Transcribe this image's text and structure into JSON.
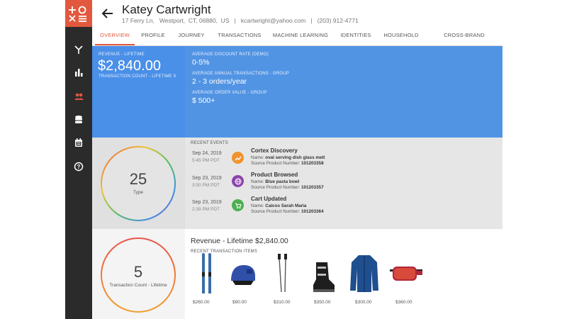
{
  "customer": {
    "name": "Katey Cartwright",
    "address": "17 Ferry Ln,   Westport,  CT, 06880,  US",
    "email": "kcartwright@yahoo.com",
    "phone": "(203) 912-4771"
  },
  "tabs": [
    {
      "label": "OVERVIEW",
      "active": true
    },
    {
      "label": "PROFILE"
    },
    {
      "label": "JOURNEY"
    },
    {
      "label": "TRANSACTIONS"
    },
    {
      "label": "MACHINE LEARNING"
    },
    {
      "label": "IDENTITIES"
    },
    {
      "label": "HOUSEHOLD"
    },
    {
      "label": "CROSS-BRAND CUSTOMER"
    }
  ],
  "summary": {
    "revenue_label": "REVENUE - LIFETIME",
    "revenue_value": "$2,840.00",
    "txn_count_label": "TRANSACTION COUNT - LIFETIME",
    "txn_count_value": "5",
    "discount_label": "AVERAGE DISCOUNT RATE (DEMO)",
    "discount_value": "0-5%",
    "annual_label": "AVERAGE ANNUAL TRANSACTIONS - GROUP",
    "annual_value": "2 - 3 orders/year",
    "aov_label": "AVERAGE ORDER VALUE - GROUP",
    "aov_value": "$ 500+"
  },
  "type_ring": {
    "value": "25",
    "label": "Type"
  },
  "events": {
    "heading": "RECENT EVENTS",
    "items": [
      {
        "date": "Sep 24, 2019",
        "time": "5:45 PM PDT",
        "title": "Cortex Discovery",
        "name_label": "Name:",
        "name": "oval serving dish glass melt",
        "source_label": "Source Product Number:",
        "source": "101203358",
        "icon": "trending-up-icon",
        "color": "#f0932e"
      },
      {
        "date": "Sep 23, 2019",
        "time": "3:50 PM PDT",
        "title": "Product Browsed",
        "name_label": "Name:",
        "name": "Blue pasta bowl",
        "source_label": "Source Product Number:",
        "source": "101203357",
        "icon": "globe-icon",
        "color": "#8e44ad"
      },
      {
        "date": "Sep 23, 2019",
        "time": "2:39 PM PDT",
        "title": "Cart Updated",
        "name_label": "Name:",
        "name": "Caicos Sarah Maria",
        "source_label": "Source Product Number:",
        "source": "101203364",
        "icon": "cart-icon",
        "color": "#4caf50"
      }
    ]
  },
  "txn_ring": {
    "value": "5",
    "label": "Transaction Count - Lifetime"
  },
  "revenue_section": {
    "title": "Revenue - Lifetime $2,840.00",
    "items_heading": "RECENT TRANSACTION ITEMS",
    "items": [
      {
        "price": "$260.00",
        "icon": "skis-icon"
      },
      {
        "price": "$90.00",
        "icon": "helmet-icon"
      },
      {
        "price": "$310.00",
        "icon": "ski-poles-icon"
      },
      {
        "price": "$350.00",
        "icon": "ski-boot-icon"
      },
      {
        "price": "$300.00",
        "icon": "jacket-icon"
      },
      {
        "price": "$360.00",
        "icon": "goggles-icon"
      }
    ]
  },
  "sidebar": {
    "items": [
      {
        "icon": "logo-icon"
      },
      {
        "icon": "branch-icon"
      },
      {
        "icon": "bar-chart-icon"
      },
      {
        "icon": "people-icon",
        "active": true
      },
      {
        "icon": "database-icon"
      },
      {
        "icon": "calendar-icon"
      },
      {
        "icon": "help-icon"
      }
    ]
  },
  "colors": {
    "accent": "#e2583e",
    "blue": "#4a8fe8",
    "sidebar": "#2b2b2b"
  }
}
